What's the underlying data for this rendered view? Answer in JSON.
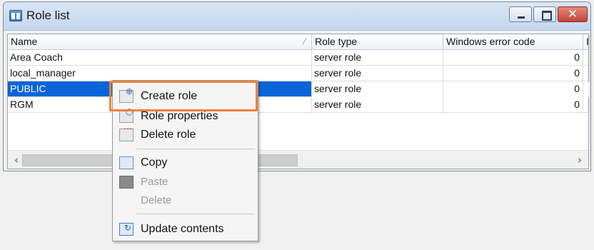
{
  "window": {
    "title": "Role list"
  },
  "columns": [
    "Name",
    "Role type",
    "Windows error code",
    "Id"
  ],
  "rows": [
    {
      "name": "Area Coach",
      "type": "server role",
      "code": "0"
    },
    {
      "name": "local_manager",
      "type": "server role",
      "code": "0"
    },
    {
      "name": "PUBLIC",
      "type": "server role",
      "code": "0",
      "selected": true
    },
    {
      "name": "RGM",
      "type": "server role",
      "code": "0"
    }
  ],
  "context_menu": {
    "items": [
      {
        "label": "Create role",
        "icon": "create-role-icon",
        "enabled": true,
        "highlighted": true
      },
      {
        "label": "Role properties",
        "icon": "role-properties-icon",
        "enabled": true
      },
      {
        "label": "Delete role",
        "icon": "delete-role-icon",
        "enabled": true
      },
      {
        "label": "Copy",
        "icon": "copy-icon",
        "enabled": true
      },
      {
        "label": "Paste",
        "icon": "paste-icon",
        "enabled": false
      },
      {
        "label": "Delete",
        "icon": "",
        "enabled": false
      },
      {
        "label": "Update contents",
        "icon": "update-contents-icon",
        "enabled": true
      }
    ]
  },
  "colors": {
    "selection": "#0a64d8",
    "highlight_border": "#f0813a",
    "close_button": "#c4443a"
  }
}
